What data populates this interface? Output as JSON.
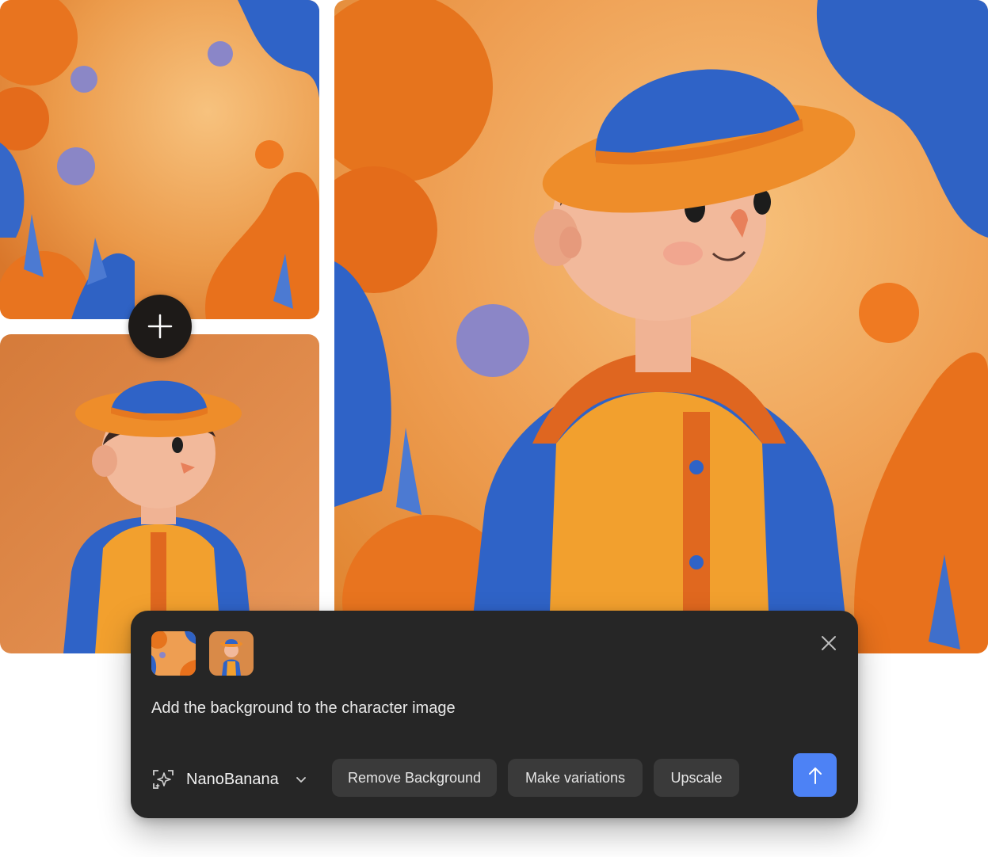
{
  "images": {
    "background_tile": "orange painted background with blue shapes and orbs",
    "character_tile": "character in blue hat and orange vest",
    "result_tile": "character composited onto painted background"
  },
  "prompt_panel": {
    "prompt_text": "Add the background to the character image",
    "model_label": "NanoBanana",
    "actions": {
      "remove_background": "Remove Background",
      "make_variations": "Make variations",
      "upscale": "Upscale"
    },
    "icons": {
      "plus": "plus-icon",
      "close": "close-icon",
      "model": "sparkle-frame-icon",
      "chevron": "chevron-down-icon",
      "send": "arrow-up-icon"
    }
  },
  "colors": {
    "panel_bg": "#262626",
    "chip_bg": "#3a3a3a",
    "send_accent": "#4d82f5",
    "orange": "#e8842e",
    "blue": "#2f6ad0"
  }
}
